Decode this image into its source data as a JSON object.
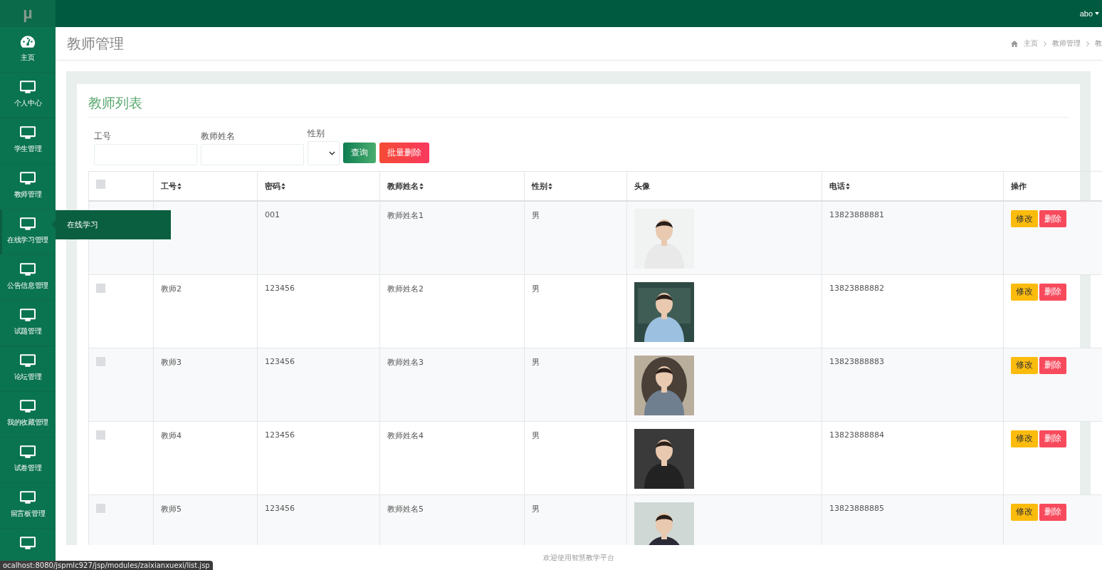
{
  "logo": "μ",
  "sidebar": {
    "items": [
      {
        "label": "主页",
        "kind": "dashboard",
        "selected": false
      },
      {
        "label": "个人中心",
        "kind": "monitor",
        "selected": false
      },
      {
        "label": "学生管理",
        "kind": "monitor",
        "selected": false
      },
      {
        "label": "教师管理",
        "kind": "monitor",
        "selected": false
      },
      {
        "label": "在线学习管理",
        "kind": "monitor",
        "selected": true
      },
      {
        "label": "公告信息管理",
        "kind": "monitor",
        "selected": false
      },
      {
        "label": "试题管理",
        "kind": "monitor",
        "selected": false
      },
      {
        "label": "论坛管理",
        "kind": "monitor",
        "selected": false
      },
      {
        "label": "我的收藏管理",
        "kind": "monitor",
        "selected": false
      },
      {
        "label": "试卷管理",
        "kind": "monitor",
        "selected": false
      },
      {
        "label": "留言板管理",
        "kind": "monitor",
        "selected": false
      },
      {
        "kind": "monitor",
        "selected": false
      }
    ]
  },
  "flyout": {
    "label": "在线学习"
  },
  "user": {
    "name": "abo"
  },
  "header": {
    "title": "教师管理",
    "breadcrumb": [
      "主页",
      "教师管理",
      "教"
    ]
  },
  "card": {
    "title": "教师列表"
  },
  "filters": [
    {
      "label": "工号",
      "kind": "input"
    },
    {
      "label": "教师姓名",
      "kind": "input"
    },
    {
      "label": "性别",
      "kind": "select"
    }
  ],
  "buttons": [
    {
      "label": "查询",
      "kind": "search"
    },
    {
      "label": "批量删除",
      "kind": "danger"
    }
  ],
  "table": {
    "select_all": {
      "checked": false
    },
    "columns": [
      {
        "label": "工号",
        "sortable": true
      },
      {
        "label": "密码",
        "sortable": true
      },
      {
        "label": "教师姓名",
        "sortable": true
      },
      {
        "label": "性别",
        "sortable": true
      },
      {
        "label": "头像",
        "sortable": false
      },
      {
        "label": "电话",
        "sortable": true
      },
      {
        "label": "操作",
        "sortable": false
      }
    ],
    "rows": [
      {
        "password": "001",
        "name": "教师姓名1",
        "gender": "男",
        "photo": {
          "kind": "picture"
        },
        "phone": "13823888881",
        "actions": [
          "修改",
          "删除"
        ]
      },
      {
        "checked": false,
        "job_id": "教师2",
        "password": "123456",
        "name": "教师姓名2",
        "gender": "男",
        "photo": {
          "kind": "picture"
        },
        "phone": "13823888882",
        "actions": [
          "修改",
          "删除"
        ]
      },
      {
        "checked": false,
        "job_id": "教师3",
        "password": "123456",
        "name": "教师姓名3",
        "gender": "男",
        "photo": {
          "kind": "picture"
        },
        "phone": "13823888883",
        "actions": [
          "修改",
          "删除"
        ]
      },
      {
        "checked": false,
        "job_id": "教师4",
        "password": "123456",
        "name": "教师姓名4",
        "gender": "男",
        "photo": {
          "kind": "picture"
        },
        "phone": "13823888884",
        "actions": [
          "修改",
          "删除"
        ]
      },
      {
        "checked": false,
        "job_id": "教师5",
        "password": "123456",
        "name": "教师姓名5",
        "gender": "男",
        "photo": {
          "kind": "picture"
        },
        "phone": "13823888885",
        "actions": [
          "修改",
          "删除"
        ]
      }
    ]
  },
  "footer": "欢迎使用智慧教学平台",
  "status_url": "ocalhost:8080/jspmlc927/jsp/modules/zaixianxuexi/list.jsp"
}
